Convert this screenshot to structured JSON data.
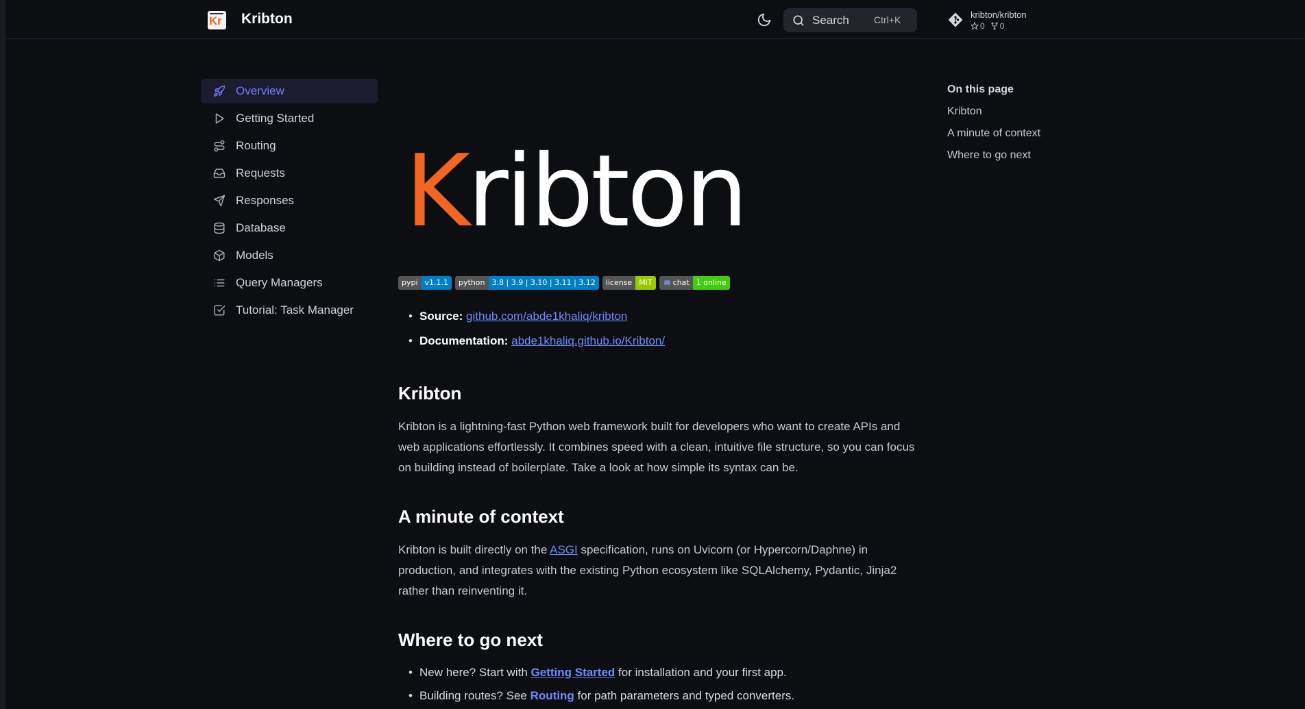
{
  "header": {
    "site_title": "Kribton",
    "search_label": "Search",
    "search_shortcut": "Ctrl+K",
    "repo_name": "kribton/kribton",
    "stars": "0",
    "forks": "0"
  },
  "sidebar": {
    "items": [
      {
        "label": "Overview",
        "icon": "rocket-icon",
        "active": true
      },
      {
        "label": "Getting Started",
        "icon": "play-icon"
      },
      {
        "label": "Routing",
        "icon": "route-icon"
      },
      {
        "label": "Requests",
        "icon": "inbox-icon"
      },
      {
        "label": "Responses",
        "icon": "send-icon"
      },
      {
        "label": "Database",
        "icon": "database-icon"
      },
      {
        "label": "Models",
        "icon": "cube-icon"
      },
      {
        "label": "Query Managers",
        "icon": "list-icon"
      },
      {
        "label": "Tutorial: Task Manager",
        "icon": "checkbox-icon"
      }
    ]
  },
  "toc": {
    "title": "On this page",
    "items": [
      "Kribton",
      "A minute of context",
      "Where to go next"
    ]
  },
  "main": {
    "hero_k": "K",
    "hero_rest": "ribton",
    "badges": [
      {
        "left": "pypi",
        "right": "v1.1.1"
      },
      {
        "left": "python",
        "right": "3.8 | 3.9 | 3.10 | 3.11 | 3.12"
      },
      {
        "left": "license",
        "right": "MIT"
      },
      {
        "left": "chat",
        "right": "1 online"
      }
    ],
    "source_label": "Source:",
    "source_link": "github.com/abde1khaliq/kribton",
    "docs_label": "Documentation:",
    "docs_link": "abde1khaliq.github.io/Kribton/",
    "section1_title": "Kribton",
    "section1_text": "Kribton is a lightning-fast Python web framework built for developers who want to create APIs and web applications effortlessly. It combines speed with a clean, intuitive file structure, so you can focus on building instead of boilerplate. Take a look at how simple its syntax can be.",
    "section2_title": "A minute of context",
    "section2_pre": "Kribton is built directly on the ",
    "section2_link": "ASGI",
    "section2_post": " specification, runs on Uvicorn (or Hypercorn/Daphne) in production, and integrates with the existing Python ecosystem like SQLAlchemy, Pydantic, Jinja2 rather than reinventing it.",
    "section3_title": "Where to go next",
    "next1_pre": "New here? Start with ",
    "next1_link": "Getting Started",
    "next1_post": " for installation and your first app.",
    "next2_pre": "Building routes? See ",
    "next2_link": "Routing",
    "next2_post": " for path parameters and typed converters."
  },
  "colors": {
    "accent": "#6d7cff",
    "brand_orange": "#f26522",
    "link": "#6d8cff"
  }
}
